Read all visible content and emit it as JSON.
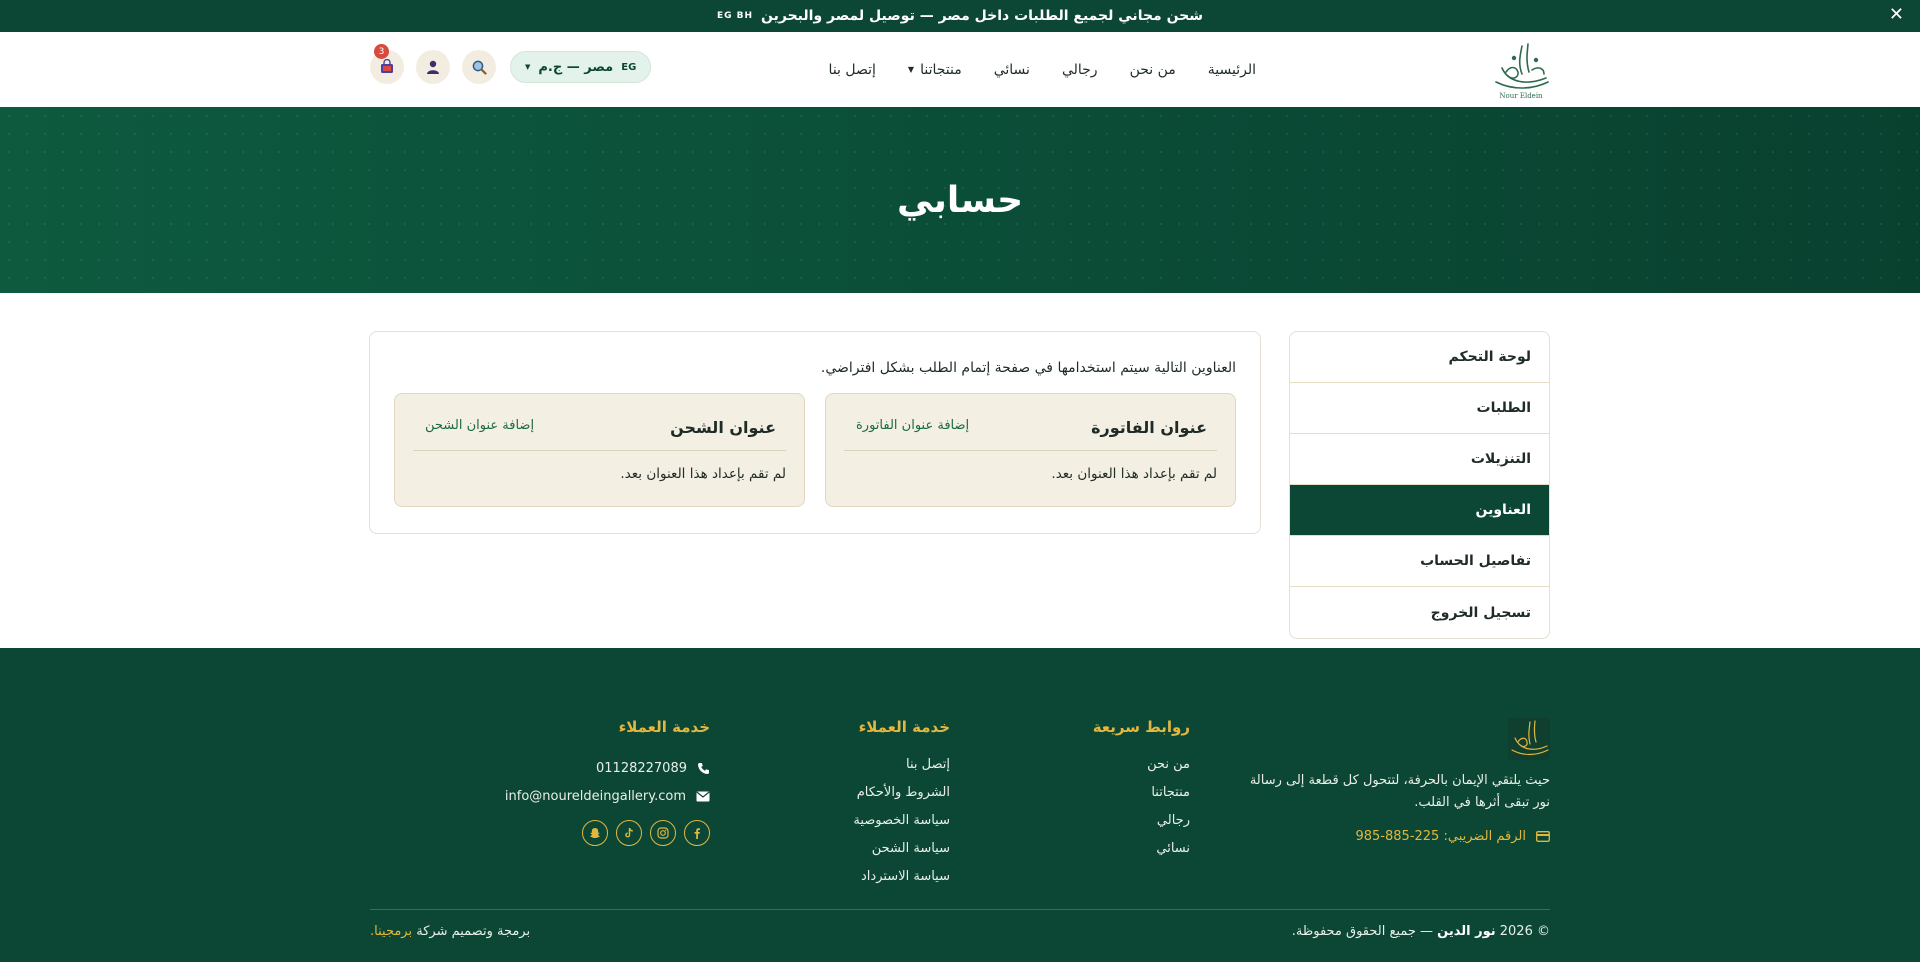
{
  "topbar": {
    "announcement": "شحن مجاني لجميع الطلبات داخل مصر — توصيل لمصر والبحرين",
    "flags": "EG BH",
    "close": "✕"
  },
  "header": {
    "logo_text": "Nour Eldein",
    "nav": [
      {
        "label": "الرئيسية"
      },
      {
        "label": "من نحن"
      },
      {
        "label": "رجالي"
      },
      {
        "label": "نسائي"
      },
      {
        "label": "منتجاتنا"
      },
      {
        "label": "إتصل بنا"
      }
    ],
    "country_code": "EG",
    "country_label": "مصر — ج.م",
    "cart_count": "3",
    "icons": [
      "search-icon",
      "user-icon",
      "cart-icon"
    ]
  },
  "hero": {
    "title": "حسابي"
  },
  "account_menu": {
    "items": [
      {
        "label": "لوحة التحكم"
      },
      {
        "label": "الطلبات"
      },
      {
        "label": "التنزيلات"
      },
      {
        "label": "العناوين"
      },
      {
        "label": "تفاصيل الحساب"
      },
      {
        "label": "تسجيل الخروج"
      }
    ],
    "active": "العناوين"
  },
  "addresses": {
    "intro": "العناوين التالية سيتم استخدامها في صفحة إتمام الطلب بشكل افتراضي.",
    "billing": {
      "title": "عنوان الفاتورة",
      "action": "إضافة عنوان الفاتورة",
      "empty": "لم تقم بإعداد هذا العنوان بعد."
    },
    "shipping": {
      "title": "عنوان الشحن",
      "action": "إضافة عنوان الشحن",
      "empty": "لم تقم بإعداد هذا العنوان بعد."
    }
  },
  "footer": {
    "about": "حيث يلتقي الإيمان بالحرفة، لتتحول كل قطعة إلى رسالة نور تبقى أثرها في القلب.",
    "tax": "الرقم الضريبي: 225-885-985",
    "quick_links": {
      "title": "روابط سريعة",
      "items": [
        {
          "label": "من نحن"
        },
        {
          "label": "منتجاتنا"
        },
        {
          "label": "رجالي"
        },
        {
          "label": "نسائي"
        }
      ]
    },
    "customer_service": {
      "title": "خدمة العملاء",
      "items": [
        {
          "label": "إتصل بنا"
        },
        {
          "label": "الشروط والأحكام"
        },
        {
          "label": "سياسة الخصوصية"
        },
        {
          "label": "سياسة الشحن"
        },
        {
          "label": "سياسة الاسترداد"
        }
      ]
    },
    "contact": {
      "title": "خدمة العملاء",
      "phone": "01128227089",
      "email": "info@noureldeingallery.com"
    },
    "socials": [
      "facebook-icon",
      "instagram-icon",
      "tiktok-icon",
      "snapchat-icon"
    ],
    "copyright_prefix": "© 2026",
    "copyright_brand": "نور الدين",
    "copyright_suffix": "— جميع الحقوق محفوظة.",
    "credit_text": "برمجة وتصميم شركة",
    "credit_company": "برمجينا."
  },
  "colors": {
    "primary": "#0b4734",
    "gold": "#e2b740",
    "cream": "#f3efe3",
    "badge": "#d84a3b"
  }
}
